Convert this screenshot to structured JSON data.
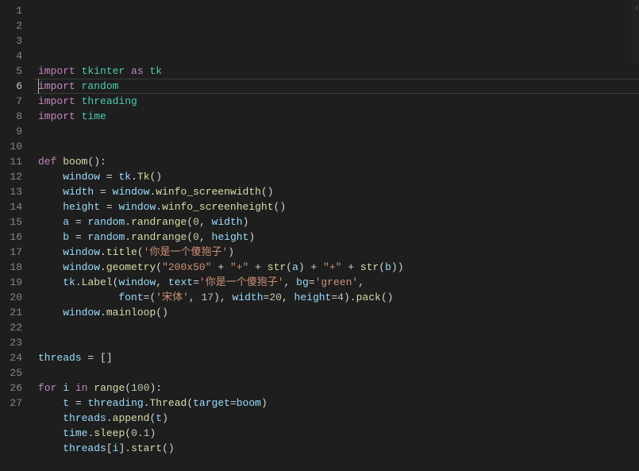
{
  "editor": {
    "current_line_index": 5,
    "lines": [
      {
        "num": 1,
        "tokens": [
          [
            "kw",
            "import"
          ],
          [
            "pun",
            " "
          ],
          [
            "mod",
            "tkinter"
          ],
          [
            "pun",
            " "
          ],
          [
            "kw",
            "as"
          ],
          [
            "pun",
            " "
          ],
          [
            "mod",
            "tk"
          ]
        ]
      },
      {
        "num": 2,
        "tokens": [
          [
            "kw",
            "import"
          ],
          [
            "pun",
            " "
          ],
          [
            "mod",
            "random"
          ]
        ]
      },
      {
        "num": 3,
        "tokens": [
          [
            "kw",
            "import"
          ],
          [
            "pun",
            " "
          ],
          [
            "mod",
            "threading"
          ]
        ]
      },
      {
        "num": 4,
        "tokens": [
          [
            "kw",
            "import"
          ],
          [
            "pun",
            " "
          ],
          [
            "mod",
            "time"
          ]
        ]
      },
      {
        "num": 5,
        "tokens": []
      },
      {
        "num": 6,
        "tokens": []
      },
      {
        "num": 7,
        "tokens": [
          [
            "kw",
            "def"
          ],
          [
            "pun",
            " "
          ],
          [
            "fn",
            "boom"
          ],
          [
            "pun",
            "():"
          ]
        ]
      },
      {
        "num": 8,
        "tokens": [
          [
            "pun",
            "    "
          ],
          [
            "var",
            "window"
          ],
          [
            "pun",
            " "
          ],
          [
            "op",
            "="
          ],
          [
            "pun",
            " "
          ],
          [
            "var",
            "tk"
          ],
          [
            "pun",
            "."
          ],
          [
            "fn",
            "Tk"
          ],
          [
            "pun",
            "()"
          ]
        ]
      },
      {
        "num": 9,
        "tokens": [
          [
            "pun",
            "    "
          ],
          [
            "var",
            "width"
          ],
          [
            "pun",
            " "
          ],
          [
            "op",
            "="
          ],
          [
            "pun",
            " "
          ],
          [
            "var",
            "window"
          ],
          [
            "pun",
            "."
          ],
          [
            "fn",
            "winfo_screenwidth"
          ],
          [
            "pun",
            "()"
          ]
        ]
      },
      {
        "num": 10,
        "tokens": [
          [
            "pun",
            "    "
          ],
          [
            "var",
            "height"
          ],
          [
            "pun",
            " "
          ],
          [
            "op",
            "="
          ],
          [
            "pun",
            " "
          ],
          [
            "var",
            "window"
          ],
          [
            "pun",
            "."
          ],
          [
            "fn",
            "winfo_screenheight"
          ],
          [
            "pun",
            "()"
          ]
        ]
      },
      {
        "num": 11,
        "tokens": [
          [
            "pun",
            "    "
          ],
          [
            "var",
            "a"
          ],
          [
            "pun",
            " "
          ],
          [
            "op",
            "="
          ],
          [
            "pun",
            " "
          ],
          [
            "var",
            "random"
          ],
          [
            "pun",
            "."
          ],
          [
            "fn",
            "randrange"
          ],
          [
            "pun",
            "("
          ],
          [
            "num",
            "0"
          ],
          [
            "pun",
            ", "
          ],
          [
            "var",
            "width"
          ],
          [
            "pun",
            ")"
          ]
        ]
      },
      {
        "num": 12,
        "tokens": [
          [
            "pun",
            "    "
          ],
          [
            "var",
            "b"
          ],
          [
            "pun",
            " "
          ],
          [
            "op",
            "="
          ],
          [
            "pun",
            " "
          ],
          [
            "var",
            "random"
          ],
          [
            "pun",
            "."
          ],
          [
            "fn",
            "randrange"
          ],
          [
            "pun",
            "("
          ],
          [
            "num",
            "0"
          ],
          [
            "pun",
            ", "
          ],
          [
            "var",
            "height"
          ],
          [
            "pun",
            ")"
          ]
        ]
      },
      {
        "num": 13,
        "tokens": [
          [
            "pun",
            "    "
          ],
          [
            "var",
            "window"
          ],
          [
            "pun",
            "."
          ],
          [
            "fn",
            "title"
          ],
          [
            "pun",
            "("
          ],
          [
            "str",
            "'你是一个傻狍子'"
          ],
          [
            "pun",
            ")"
          ]
        ]
      },
      {
        "num": 14,
        "tokens": [
          [
            "pun",
            "    "
          ],
          [
            "var",
            "window"
          ],
          [
            "pun",
            "."
          ],
          [
            "fn",
            "geometry"
          ],
          [
            "pun",
            "("
          ],
          [
            "str",
            "\"200x50\""
          ],
          [
            "pun",
            " "
          ],
          [
            "op",
            "+"
          ],
          [
            "pun",
            " "
          ],
          [
            "str",
            "\"+\""
          ],
          [
            "pun",
            " "
          ],
          [
            "op",
            "+"
          ],
          [
            "pun",
            " "
          ],
          [
            "fn",
            "str"
          ],
          [
            "pun",
            "("
          ],
          [
            "var",
            "a"
          ],
          [
            "pun",
            ") "
          ],
          [
            "op",
            "+"
          ],
          [
            "pun",
            " "
          ],
          [
            "str",
            "\"+\""
          ],
          [
            "pun",
            " "
          ],
          [
            "op",
            "+"
          ],
          [
            "pun",
            " "
          ],
          [
            "fn",
            "str"
          ],
          [
            "pun",
            "("
          ],
          [
            "var",
            "b"
          ],
          [
            "pun",
            "))"
          ]
        ]
      },
      {
        "num": 15,
        "tokens": [
          [
            "pun",
            "    "
          ],
          [
            "var",
            "tk"
          ],
          [
            "pun",
            "."
          ],
          [
            "fn",
            "Label"
          ],
          [
            "pun",
            "("
          ],
          [
            "var",
            "window"
          ],
          [
            "pun",
            ", "
          ],
          [
            "var",
            "text"
          ],
          [
            "op",
            "="
          ],
          [
            "str",
            "'你是一个傻狍子'"
          ],
          [
            "pun",
            ", "
          ],
          [
            "var",
            "bg"
          ],
          [
            "op",
            "="
          ],
          [
            "str",
            "'green'"
          ],
          [
            "pun",
            ","
          ]
        ]
      },
      {
        "num": 16,
        "tokens": [
          [
            "pun",
            "             "
          ],
          [
            "var",
            "font"
          ],
          [
            "op",
            "="
          ],
          [
            "pun",
            "("
          ],
          [
            "str",
            "'宋体'"
          ],
          [
            "pun",
            ", "
          ],
          [
            "num",
            "17"
          ],
          [
            "pun",
            "), "
          ],
          [
            "var",
            "width"
          ],
          [
            "op",
            "="
          ],
          [
            "num",
            "20"
          ],
          [
            "pun",
            ", "
          ],
          [
            "var",
            "height"
          ],
          [
            "op",
            "="
          ],
          [
            "num",
            "4"
          ],
          [
            "pun",
            ")."
          ],
          [
            "fn",
            "pack"
          ],
          [
            "pun",
            "()"
          ]
        ]
      },
      {
        "num": 17,
        "tokens": [
          [
            "pun",
            "    "
          ],
          [
            "var",
            "window"
          ],
          [
            "pun",
            "."
          ],
          [
            "fn",
            "mainloop"
          ],
          [
            "pun",
            "()"
          ]
        ]
      },
      {
        "num": 18,
        "tokens": []
      },
      {
        "num": 19,
        "tokens": []
      },
      {
        "num": 20,
        "tokens": [
          [
            "var",
            "threads"
          ],
          [
            "pun",
            " "
          ],
          [
            "op",
            "="
          ],
          [
            "pun",
            " []"
          ]
        ]
      },
      {
        "num": 21,
        "tokens": []
      },
      {
        "num": 22,
        "tokens": [
          [
            "kw",
            "for"
          ],
          [
            "pun",
            " "
          ],
          [
            "var",
            "i"
          ],
          [
            "pun",
            " "
          ],
          [
            "kw",
            "in"
          ],
          [
            "pun",
            " "
          ],
          [
            "fn",
            "range"
          ],
          [
            "pun",
            "("
          ],
          [
            "num",
            "100"
          ],
          [
            "pun",
            "):"
          ]
        ]
      },
      {
        "num": 23,
        "tokens": [
          [
            "pun",
            "    "
          ],
          [
            "var",
            "t"
          ],
          [
            "pun",
            " "
          ],
          [
            "op",
            "="
          ],
          [
            "pun",
            " "
          ],
          [
            "var",
            "threading"
          ],
          [
            "pun",
            "."
          ],
          [
            "fn",
            "Thread"
          ],
          [
            "pun",
            "("
          ],
          [
            "var",
            "target"
          ],
          [
            "op",
            "="
          ],
          [
            "var",
            "boom"
          ],
          [
            "pun",
            ")"
          ]
        ]
      },
      {
        "num": 24,
        "tokens": [
          [
            "pun",
            "    "
          ],
          [
            "var",
            "threads"
          ],
          [
            "pun",
            "."
          ],
          [
            "fn",
            "append"
          ],
          [
            "pun",
            "("
          ],
          [
            "var",
            "t"
          ],
          [
            "pun",
            ")"
          ]
        ]
      },
      {
        "num": 25,
        "tokens": [
          [
            "pun",
            "    "
          ],
          [
            "var",
            "time"
          ],
          [
            "pun",
            "."
          ],
          [
            "fn",
            "sleep"
          ],
          [
            "pun",
            "("
          ],
          [
            "num",
            "0.1"
          ],
          [
            "pun",
            ")"
          ]
        ]
      },
      {
        "num": 26,
        "tokens": [
          [
            "pun",
            "    "
          ],
          [
            "var",
            "threads"
          ],
          [
            "pun",
            "["
          ],
          [
            "var",
            "i"
          ],
          [
            "pun",
            "]."
          ],
          [
            "fn",
            "start"
          ],
          [
            "pun",
            "()"
          ]
        ]
      },
      {
        "num": 27,
        "tokens": []
      }
    ]
  }
}
